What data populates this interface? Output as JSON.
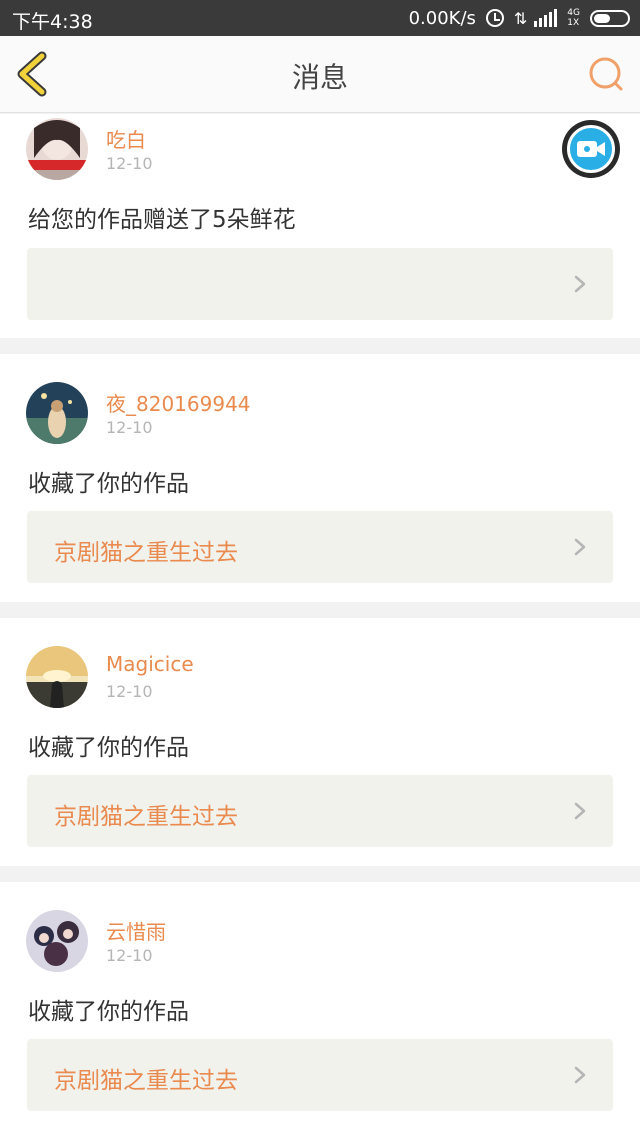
{
  "status_bar": {
    "time": "下午4:38",
    "net_speed": "0.00K/s",
    "net_type_top": "4G",
    "net_type_bottom": "1X"
  },
  "header": {
    "title": "消息",
    "accent_color": "#e98a4e"
  },
  "messages": [
    {
      "username": "吃白",
      "date": "12-10",
      "action": "给您的作品赠送了5朵鲜花",
      "work_title": ""
    },
    {
      "username": "夜_820169944",
      "date": "12-10",
      "action": "收藏了你的作品",
      "work_title": "京剧猫之重生过去"
    },
    {
      "username": "Magicice",
      "date": "12-10",
      "action": "收藏了你的作品",
      "work_title": "京剧猫之重生过去"
    },
    {
      "username": "云惜雨",
      "date": "12-10",
      "action": "收藏了你的作品",
      "work_title": "京剧猫之重生过去"
    }
  ],
  "icons": {
    "back": "chevron-left-icon",
    "search": "search-icon",
    "video": "video-camera-icon",
    "arrow": "chevron-right-icon"
  }
}
